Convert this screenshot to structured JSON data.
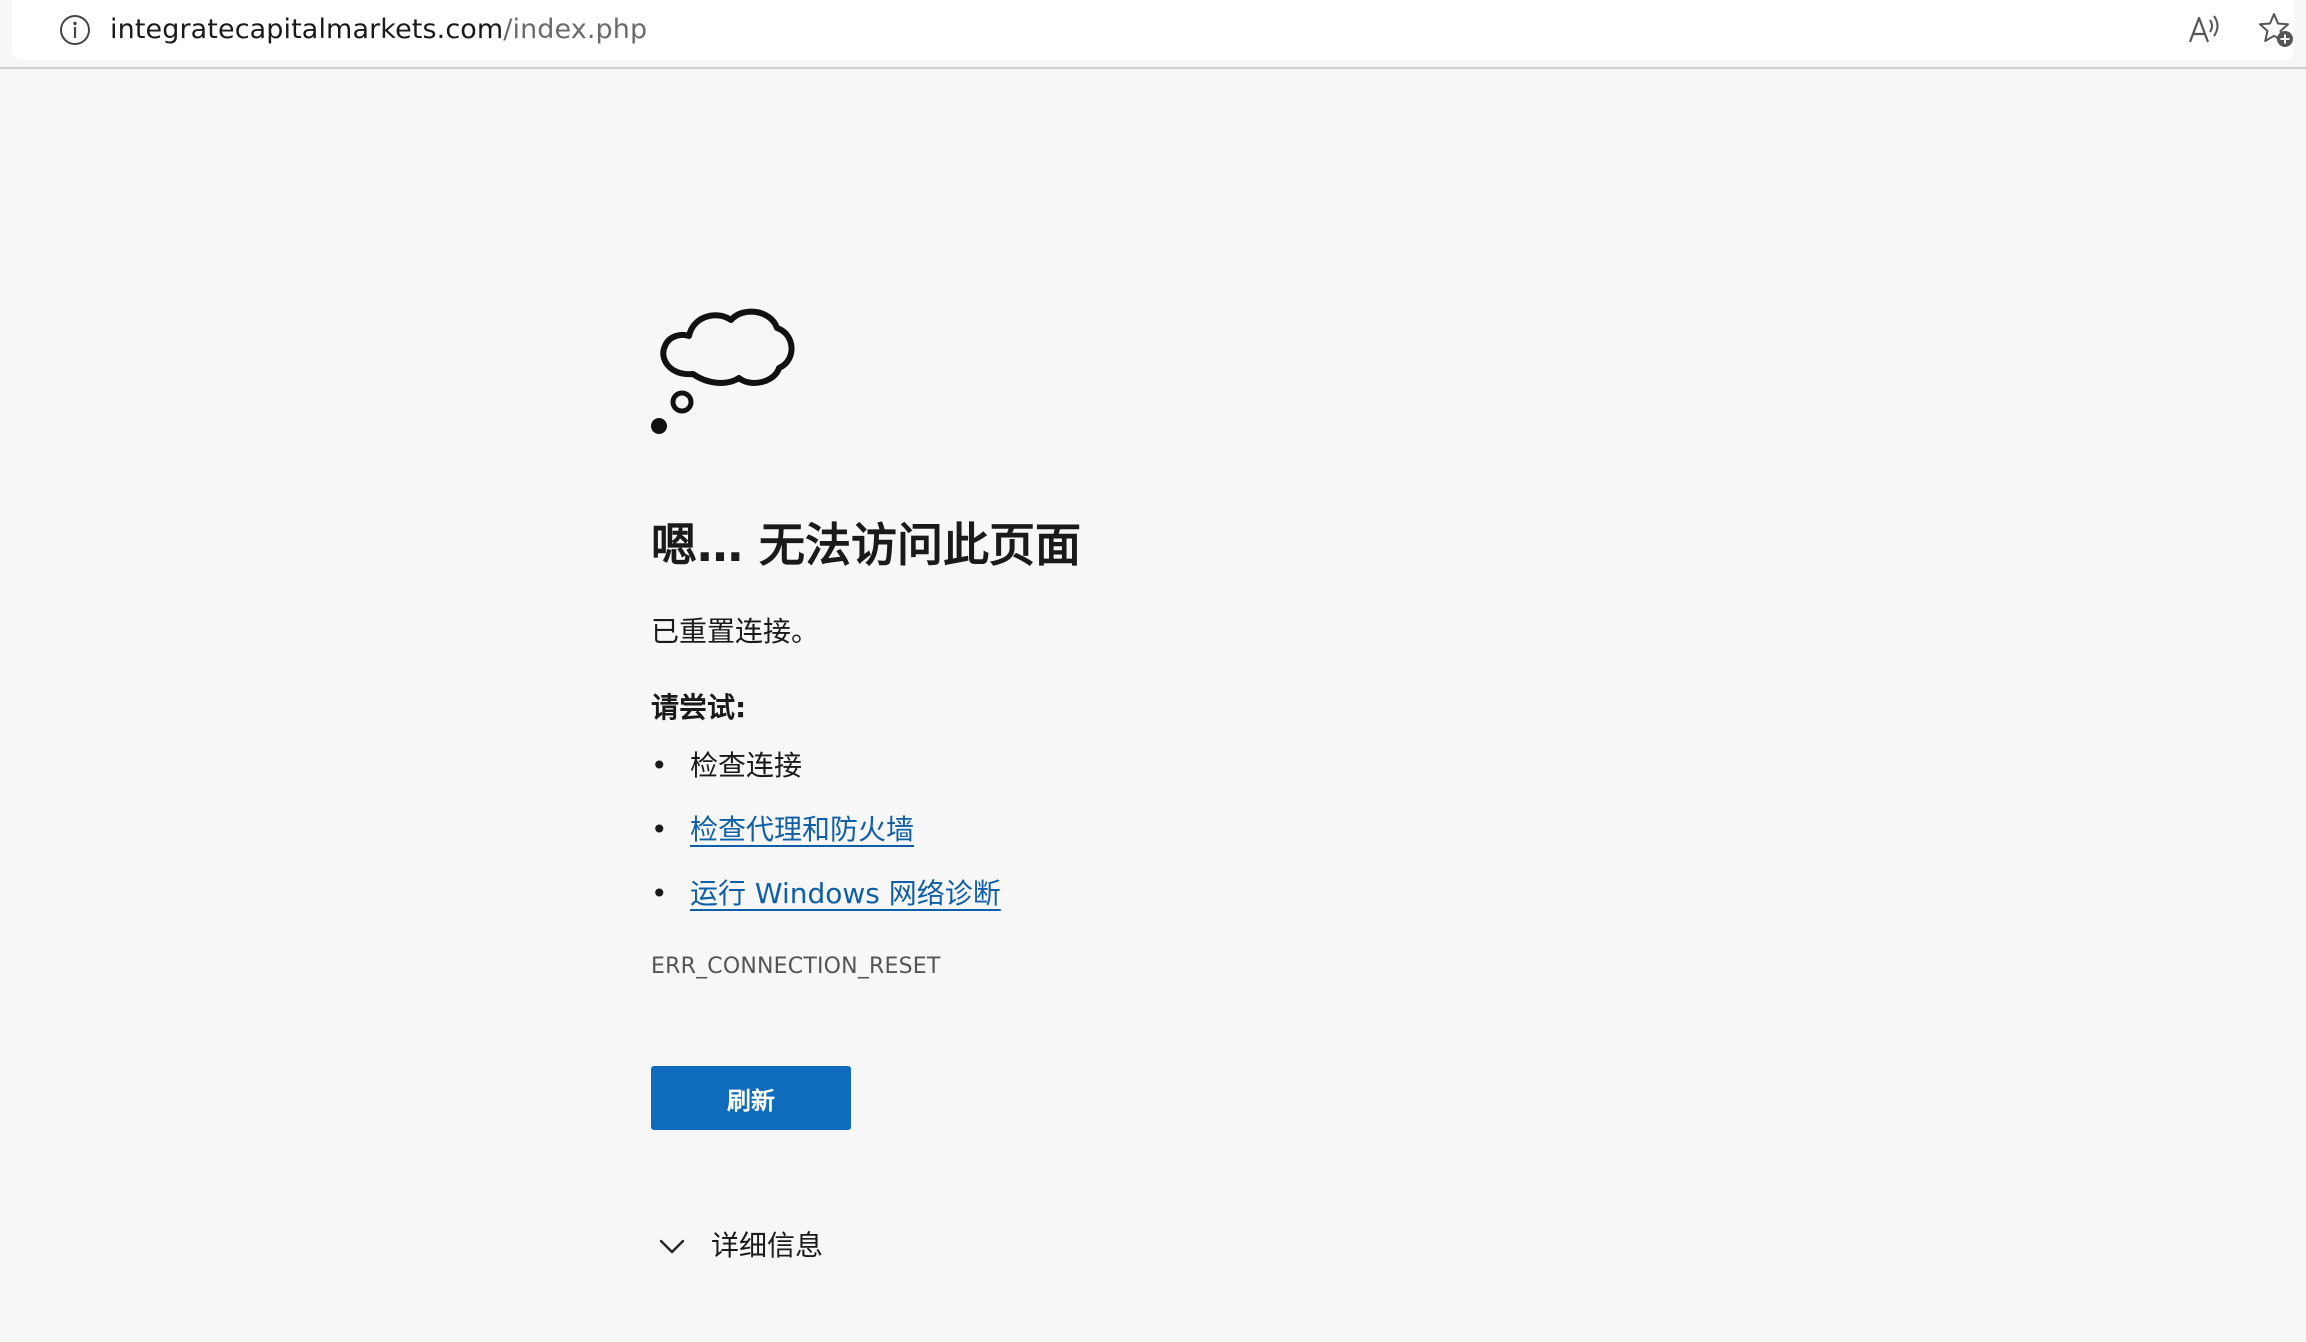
{
  "browser": {
    "url_host": "integratecapitalmarkets.com",
    "url_path": "/index.php",
    "icons": [
      "info-icon",
      "read-aloud-icon",
      "add-favorite-icon"
    ]
  },
  "error": {
    "icon": "thought-bubble-icon",
    "heading": "嗯… 无法访问此页面",
    "message": "已重置连接。",
    "try_title": "请尝试:",
    "suggestions": [
      {
        "text": "检查连接",
        "link": false
      },
      {
        "text": "检查代理和防火墙",
        "link": true
      },
      {
        "text": "运行 Windows 网络诊断",
        "link": true
      }
    ],
    "bullet": "•",
    "code": "ERR_CONNECTION_RESET",
    "refresh_label": "刷新",
    "details_label": "详细信息"
  },
  "colors": {
    "background": "#f7f7f7",
    "link": "#0f5fa8",
    "button": "#0f6cbd"
  }
}
